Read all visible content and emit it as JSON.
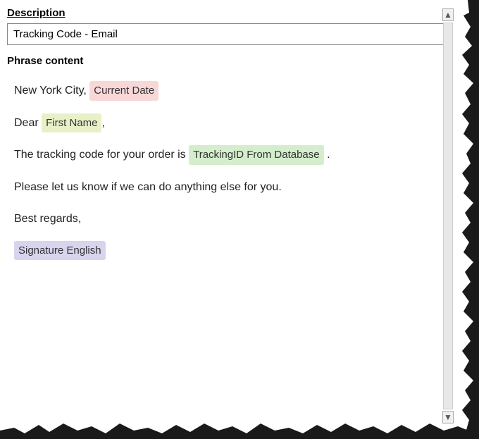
{
  "description": {
    "label": "Description",
    "input_value": "Tracking Code - Email"
  },
  "phrase_content": {
    "label": "Phrase content",
    "paragraphs": [
      {
        "id": "p1",
        "parts": [
          {
            "type": "text",
            "value": "New York City, "
          },
          {
            "type": "tag",
            "value": "Current Date",
            "style": "pink"
          },
          {
            "type": "text",
            "value": ""
          }
        ]
      },
      {
        "id": "p2",
        "parts": [
          {
            "type": "text",
            "value": "Dear "
          },
          {
            "type": "tag",
            "value": "First Name",
            "style": "yellow"
          },
          {
            "type": "text",
            "value": ","
          }
        ]
      },
      {
        "id": "p3",
        "parts": [
          {
            "type": "text",
            "value": "The tracking code for your order is "
          },
          {
            "type": "tag",
            "value": "TrackingID From Database",
            "style": "green"
          },
          {
            "type": "text",
            "value": "."
          }
        ]
      },
      {
        "id": "p4",
        "parts": [
          {
            "type": "text",
            "value": "Please let us know if we can do anything else for you."
          }
        ]
      },
      {
        "id": "p5",
        "parts": [
          {
            "type": "text",
            "value": "Best regards,"
          }
        ]
      },
      {
        "id": "p6",
        "parts": [
          {
            "type": "tag",
            "value": "Signature English",
            "style": "lavender"
          }
        ]
      }
    ]
  },
  "scrollbar": {
    "up_arrow": "▲",
    "down_arrow": "▼"
  }
}
